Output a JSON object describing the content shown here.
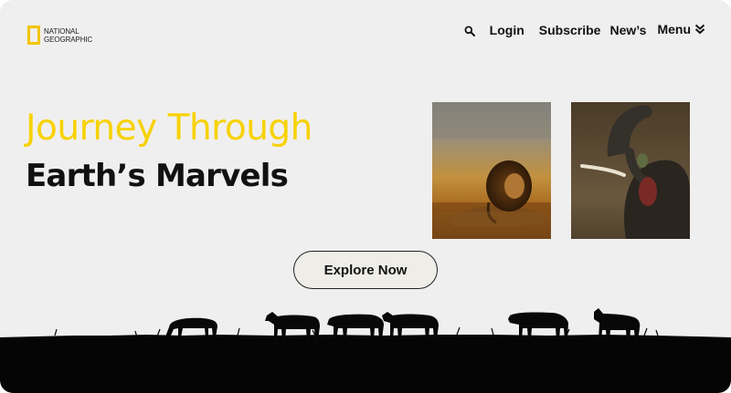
{
  "brand": {
    "logo_line1": "NATIONAL",
    "logo_line2": "GEOGRAPHIC",
    "accent_color": "#f7d200",
    "logo_color": "#f2c400"
  },
  "nav": {
    "search_icon": "search-icon",
    "login": "Login",
    "subscribe": "Subscribe",
    "news": "New’s",
    "menu": "Menu",
    "menu_icon": "double-chevron-down-icon"
  },
  "hero": {
    "headline_line1": "Journey Through",
    "headline_line2": "Earth’s Marvels",
    "cta_label": "Explore Now"
  },
  "photos": [
    {
      "subject": "lion"
    },
    {
      "subject": "elephant"
    }
  ]
}
